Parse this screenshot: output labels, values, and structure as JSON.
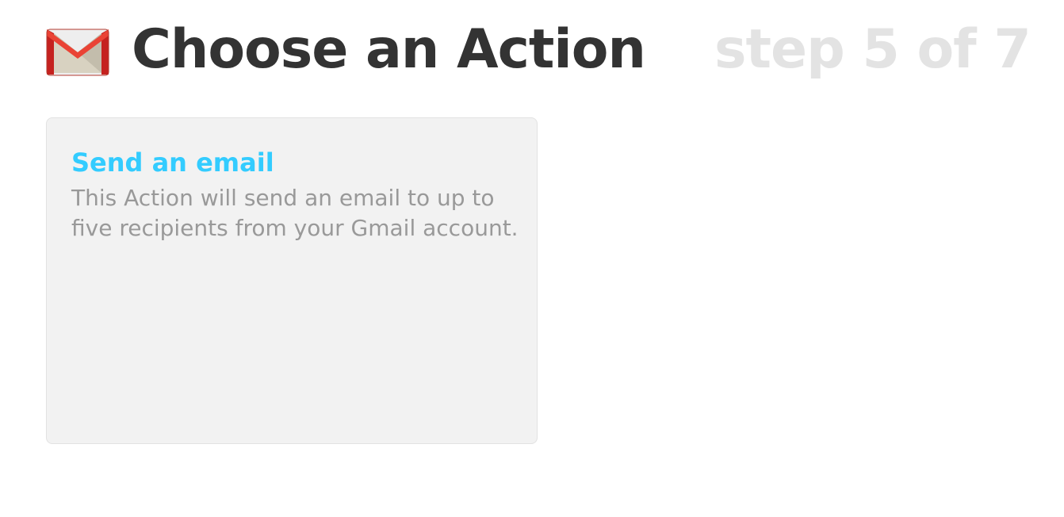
{
  "header": {
    "icon": "gmail-envelope-icon",
    "title": "Choose an Action",
    "step": "step 5 of 7"
  },
  "actions": [
    {
      "title": "Send an email",
      "description": "This Action will send an email to up to five recipients from your Gmail account."
    }
  ],
  "colors": {
    "title": "#333333",
    "step": "#e3e3e3",
    "action_title": "#33ccff",
    "action_description": "#999999",
    "card_background": "#f2f2f2",
    "gmail_red": "#d93025"
  }
}
